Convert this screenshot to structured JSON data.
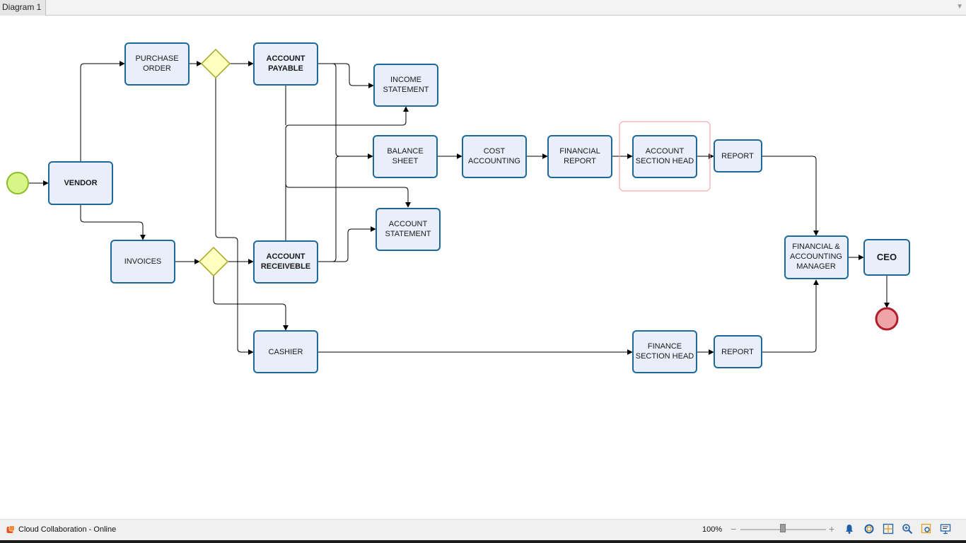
{
  "tabs": [
    {
      "label": "Diagram 1"
    }
  ],
  "diagram": {
    "tasks": {
      "vendor": [
        "VENDOR"
      ],
      "purchase_order": [
        "PURCHASE",
        "ORDER"
      ],
      "invoices": [
        "INVOICES"
      ],
      "account_payable": [
        "ACCOUNT",
        "PAYABLE"
      ],
      "account_receivable": [
        "ACCOUNT",
        "RECEIVEBLE"
      ],
      "income_statement": [
        "INCOME",
        "STATEMENT"
      ],
      "balance_sheet": [
        "BALANCE",
        "SHEET"
      ],
      "account_statement": [
        "ACCOUNT",
        "STATEMENT"
      ],
      "cost_accounting": [
        "COST",
        "ACCOUNTING"
      ],
      "financial_report": [
        "FINANCIAL",
        "REPORT"
      ],
      "account_section_head": [
        "ACCOUNT",
        "SECTION HEAD"
      ],
      "report_top": [
        "REPORT"
      ],
      "cashier": [
        "CASHIER"
      ],
      "finance_section_head": [
        "FINANCE",
        "SECTION HEAD"
      ],
      "report_bottom": [
        "REPORT"
      ],
      "fin_acc_manager": [
        "FINANCIAL &",
        "ACCOUNTING",
        "MANAGER"
      ],
      "ceo": [
        "CEO"
      ]
    }
  },
  "status": {
    "text": "Cloud Collaboration - Online",
    "zoom": "100%"
  },
  "toolbar": {
    "icons": [
      "bell-icon",
      "zoom-fit-icon",
      "grid-icon",
      "zoom-in-icon",
      "zoom-area-icon",
      "presentation-icon"
    ]
  },
  "colors": {
    "task_fill": "#e8eefa",
    "task_stroke": "#1d6a9a",
    "gateway_fill": "#ffffc0",
    "gateway_stroke": "#a5a520",
    "start_fill": "#d8f58a",
    "end_fill": "#eea4a8"
  }
}
